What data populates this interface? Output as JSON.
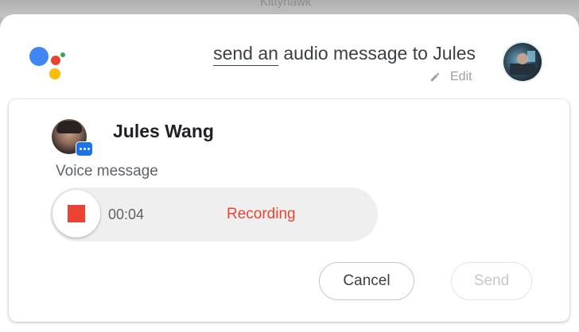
{
  "background": {
    "map_label": "Kittyhawk"
  },
  "assistant": {
    "logo_colors": [
      "#4285f4",
      "#ea4335",
      "#fbbc04",
      "#34a853"
    ],
    "query_underlined": "send an",
    "query_rest": " audio message to Jules",
    "edit_label": "Edit",
    "edit_icon": "pencil-icon"
  },
  "contact": {
    "name": "Jules Wang",
    "badge_icon": "chat-bubble-icon"
  },
  "voice_message": {
    "label": "Voice message",
    "timer": "00:04",
    "status": "Recording",
    "stop_icon": "stop-icon"
  },
  "actions": {
    "cancel_label": "Cancel",
    "send_label": "Send"
  },
  "colors": {
    "accent_blue": "#1a73e8",
    "recording_red": "#ea4335"
  }
}
